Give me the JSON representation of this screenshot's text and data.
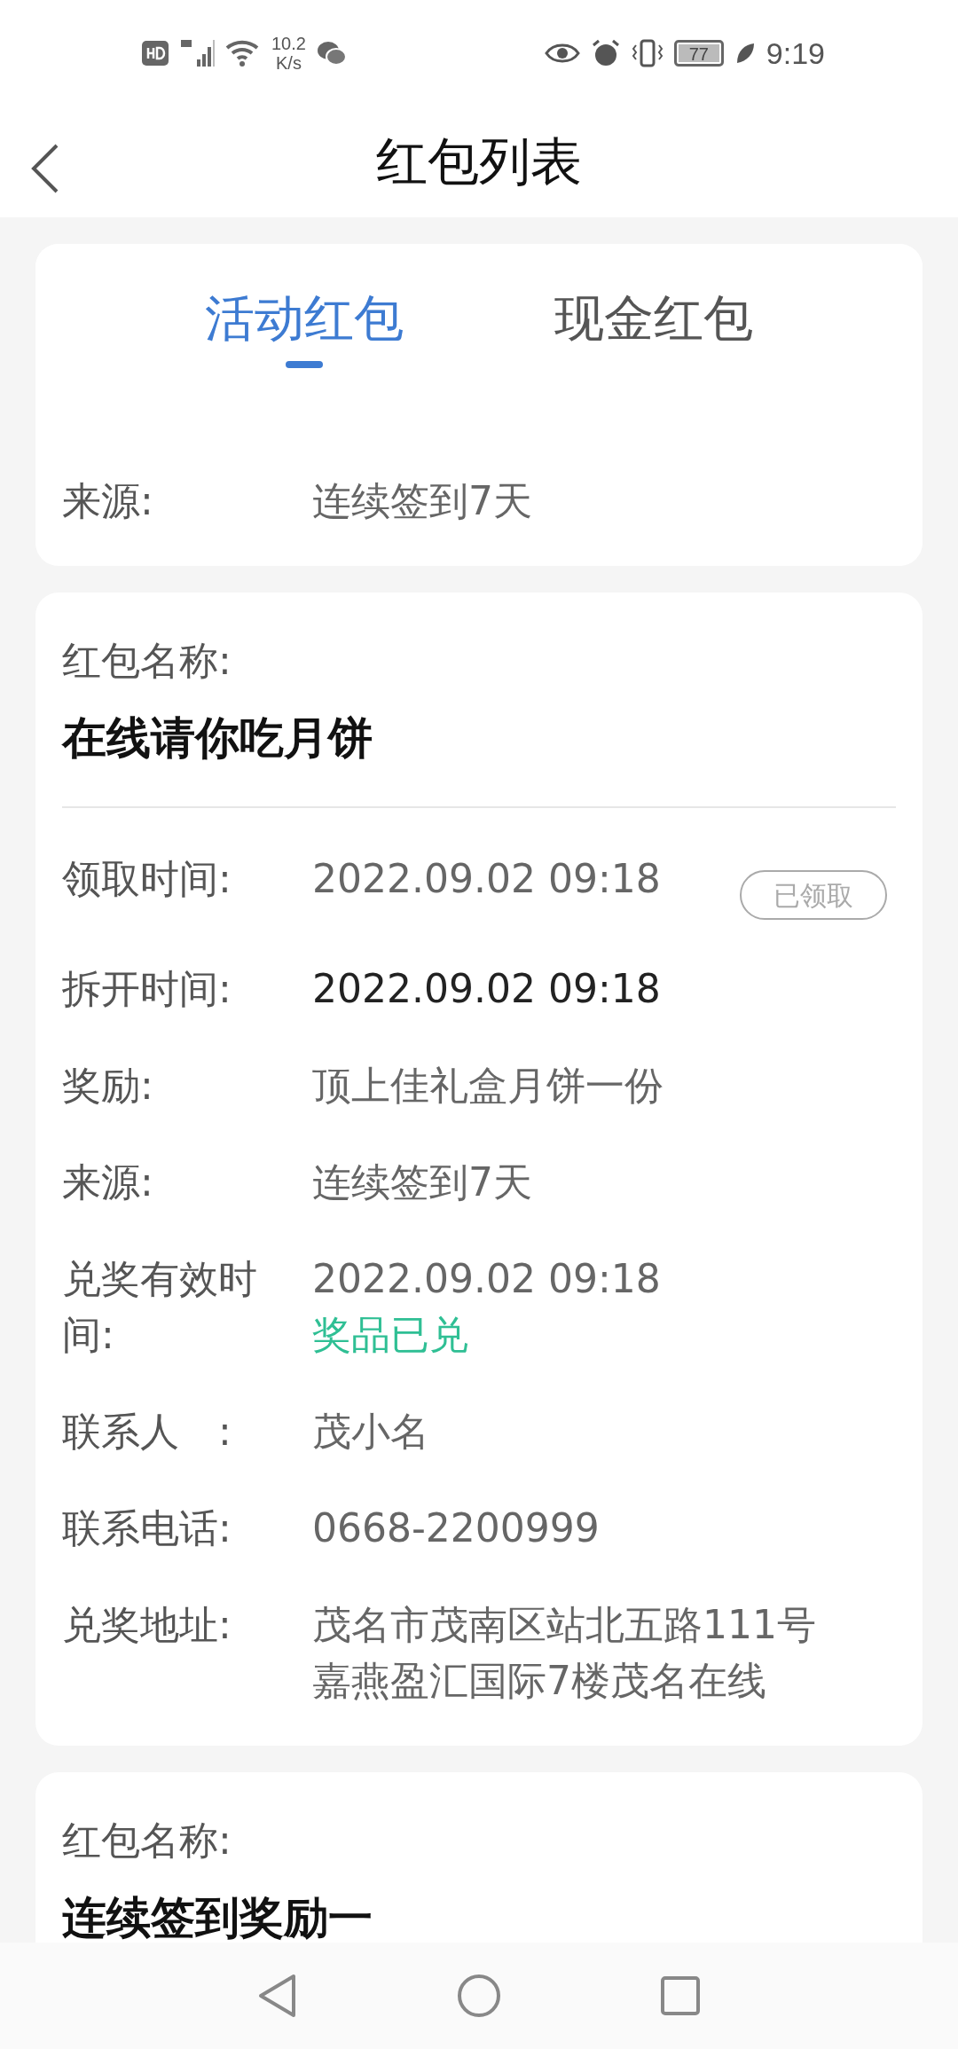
{
  "status_bar": {
    "speed_value": "10.2",
    "speed_unit": "K/s",
    "battery": "77",
    "time": "9:19"
  },
  "header": {
    "title": "红包列表"
  },
  "tabs": [
    {
      "label": "活动红包",
      "selected": true
    },
    {
      "label": "现金红包",
      "selected": false
    }
  ],
  "cards": [
    {
      "rows": [
        {
          "label": "来源:",
          "value": "连续签到7天",
          "emphasis": false
        }
      ]
    },
    {
      "name_label": "红包名称:",
      "name": "在线请你吃月饼",
      "rows": [
        {
          "label": "领取时间:",
          "value": "2022.09.02 09:18",
          "emphasis": false,
          "badge": "已领取"
        },
        {
          "label": "拆开时间:",
          "value": "2022.09.02 09:18",
          "emphasis": true
        },
        {
          "label": "奖励:",
          "value": "顶上佳礼盒月饼一份",
          "emphasis": false
        },
        {
          "label": "来源:",
          "value": "连续签到7天",
          "emphasis": false
        },
        {
          "label": "兑奖有效时间:",
          "value": "2022.09.02 09:18",
          "emphasis": false,
          "note": "奖品已兑"
        },
        {
          "label": "联系人　:",
          "value": "茂小名",
          "emphasis": false
        },
        {
          "label": "联系电话:",
          "value": "0668-2200999",
          "emphasis": false
        },
        {
          "label": "兑奖地址:",
          "value": "茂名市茂南区站北五路111号嘉燕盈汇国际7楼茂名在线",
          "emphasis": false
        }
      ]
    },
    {
      "name_label": "红包名称:",
      "name": "连续签到奖励一"
    }
  ]
}
